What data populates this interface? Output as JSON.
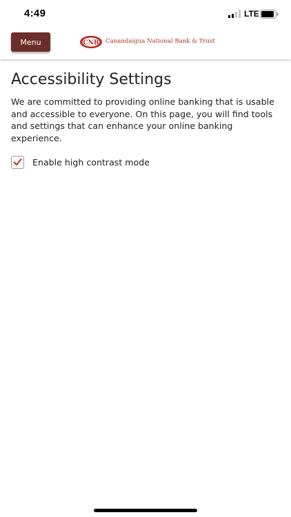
{
  "status_bar": {
    "time": "4:49",
    "network": "LTE"
  },
  "header": {
    "menu_label": "Menu",
    "logo_text": "Canandaigua National Bank & Trust",
    "logo_monogram": "CNB"
  },
  "page": {
    "title": "Accessibility Settings",
    "intro": "We are committed to providing online banking that is usable and accessible to everyone. On this page, you will find tools and settings that can enhance your online banking experience.",
    "high_contrast": {
      "label": "Enable high contrast mode",
      "checked": true
    }
  },
  "colors": {
    "menu_button": "#6b2f2a",
    "brand_red": "#b22b24",
    "check_mark": "#b22b24"
  }
}
